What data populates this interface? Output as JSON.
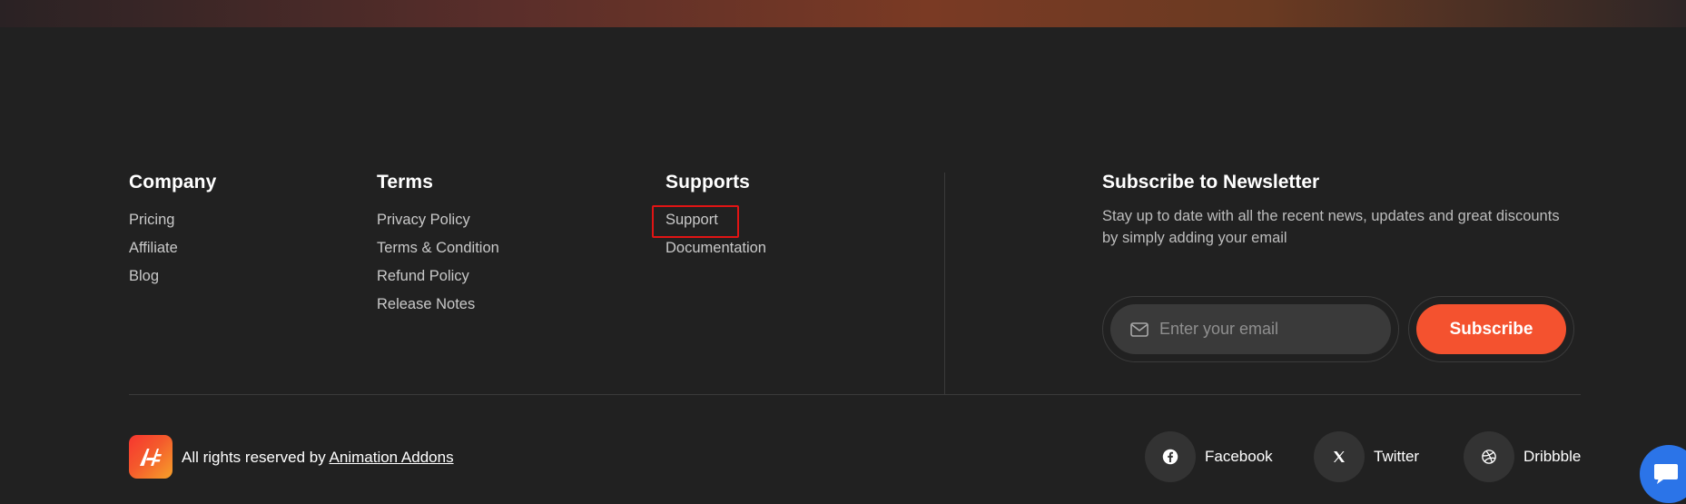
{
  "company": {
    "heading": "Company",
    "links": [
      "Pricing",
      "Affiliate",
      "Blog"
    ]
  },
  "terms": {
    "heading": "Terms",
    "links": [
      "Privacy Policy",
      "Terms & Condition",
      "Refund Policy",
      "Release Notes"
    ]
  },
  "supports": {
    "heading": "Supports",
    "links": [
      "Support",
      "Documentation"
    ]
  },
  "newsletter": {
    "heading": "Subscribe to Newsletter",
    "description": "Stay up to date with all the recent news, updates and great discounts by simply adding your email",
    "email_placeholder": "Enter your email",
    "email_value": "",
    "subscribe_label": "Subscribe",
    "mail_icon": "mail-icon"
  },
  "bottom": {
    "copyright_prefix": "All rights reserved by",
    "brand_link": "Animation Addons",
    "logo_icon": "animation-addons-logo"
  },
  "social": [
    {
      "label": "Facebook",
      "icon": "facebook-icon"
    },
    {
      "label": "Twitter",
      "icon": "x-twitter-icon"
    },
    {
      "label": "Dribbble",
      "icon": "dribbble-icon"
    }
  ],
  "chat": {
    "icon": "chat-icon"
  },
  "colors": {
    "background": "#212121",
    "accent": "#f4522f",
    "highlight_border": "#e01414",
    "chat": "#2b74e8"
  }
}
